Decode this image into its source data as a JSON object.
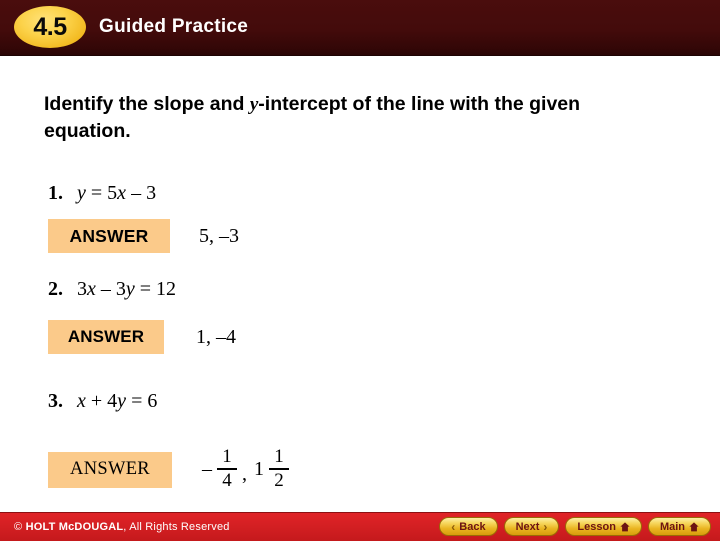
{
  "header": {
    "badge_number": "4.5",
    "title": "Guided Practice",
    "bg_color": "#430b0b",
    "badge_color": "#f3bb23"
  },
  "main": {
    "prompt_part1": "Identify the slope and ",
    "prompt_variable": "y",
    "prompt_part2": "-intercept of the line with the given equation.",
    "answer_label": "ANSWER",
    "answer_box_color": "#fbca8a",
    "problems": [
      {
        "number": "1.",
        "equation_plain": "y = 5x – 3",
        "equation_parts": {
          "lhs_var": "y",
          "operator1": " = 5",
          "var2": "x",
          "rhs": " – 3"
        },
        "answer_plain": "5, –3",
        "answer_type": "simple"
      },
      {
        "number": "2.",
        "equation_plain": "3x – 3y = 12",
        "equation_parts": {
          "coef1": "3",
          "var1": "x",
          "operator1": " – 3",
          "var2": "y",
          "rhs": " = 12"
        },
        "answer_plain": "1, –4",
        "answer_type": "simple"
      },
      {
        "number": "3.",
        "equation_plain": "x + 4y = 6",
        "equation_parts": {
          "var1": "x",
          "operator1": " + 4",
          "var2": "y",
          "rhs": " = 6"
        },
        "answer_type": "fraction",
        "answer_fraction": {
          "sign": "–",
          "first_numerator": "1",
          "first_denominator": "4",
          "separator": ",",
          "second_whole": "1",
          "second_numerator": "1",
          "second_denominator": "2"
        }
      }
    ]
  },
  "footer": {
    "copyright_symbol": "© ",
    "copyright_brand": "HOLT McDOUGAL",
    "copyright_rest": ", All Rights Reserved",
    "bg_color": "#d31f22",
    "buttons": [
      {
        "label": "Back",
        "icon": "chevron-left-icon",
        "glyph": "‹",
        "icon_side": "left"
      },
      {
        "label": "Next",
        "icon": "chevron-right-icon",
        "glyph": "›",
        "icon_side": "right"
      },
      {
        "label": "Lesson",
        "icon": "home-icon",
        "glyph": "home",
        "icon_side": "right"
      },
      {
        "label": "Main",
        "icon": "home-icon",
        "glyph": "home",
        "icon_side": "right"
      }
    ]
  }
}
